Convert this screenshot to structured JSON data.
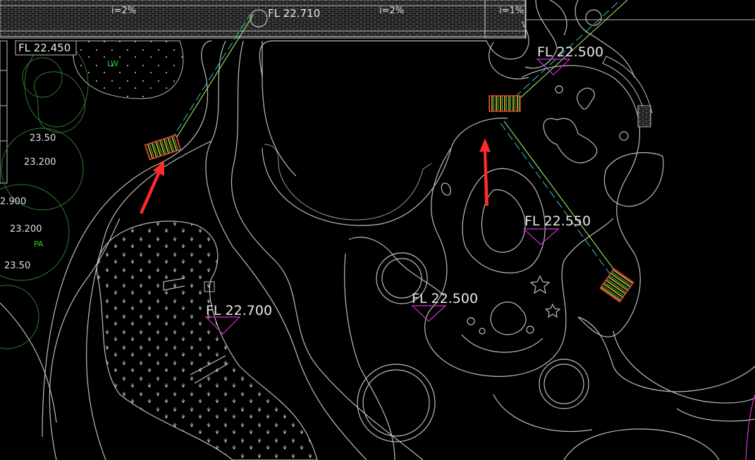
{
  "top_strip": {
    "slope_left": "i=2%",
    "slope_right": "i=2%",
    "slope_far": "i=1%",
    "top_level": "FL 22.710"
  },
  "levels": [
    {
      "id": "fl-22-450",
      "text": "FL 22.450"
    },
    {
      "id": "fl-22-500-top",
      "text": "FL 22.500"
    },
    {
      "id": "fl-22-550",
      "text": "FL 22.550"
    },
    {
      "id": "fl-22-500-mid",
      "text": "FL 22.500"
    },
    {
      "id": "fl-22-700",
      "text": "FL 22.700"
    }
  ],
  "spot_heights": [
    "23.50",
    "23.200",
    "2.900",
    "23.200",
    "23.50"
  ],
  "zone_labels": [
    "LW",
    "PA"
  ],
  "colors": {
    "background": "#000000",
    "linework": "#bdbdbd",
    "level_marker": "#cc33cc",
    "annotation_arrow": "#ff2a2a",
    "drain_line_green": "#b6ff6a",
    "drain_line_cyan": "#33cccc",
    "tree_canopy": "#2e7d2e"
  }
}
